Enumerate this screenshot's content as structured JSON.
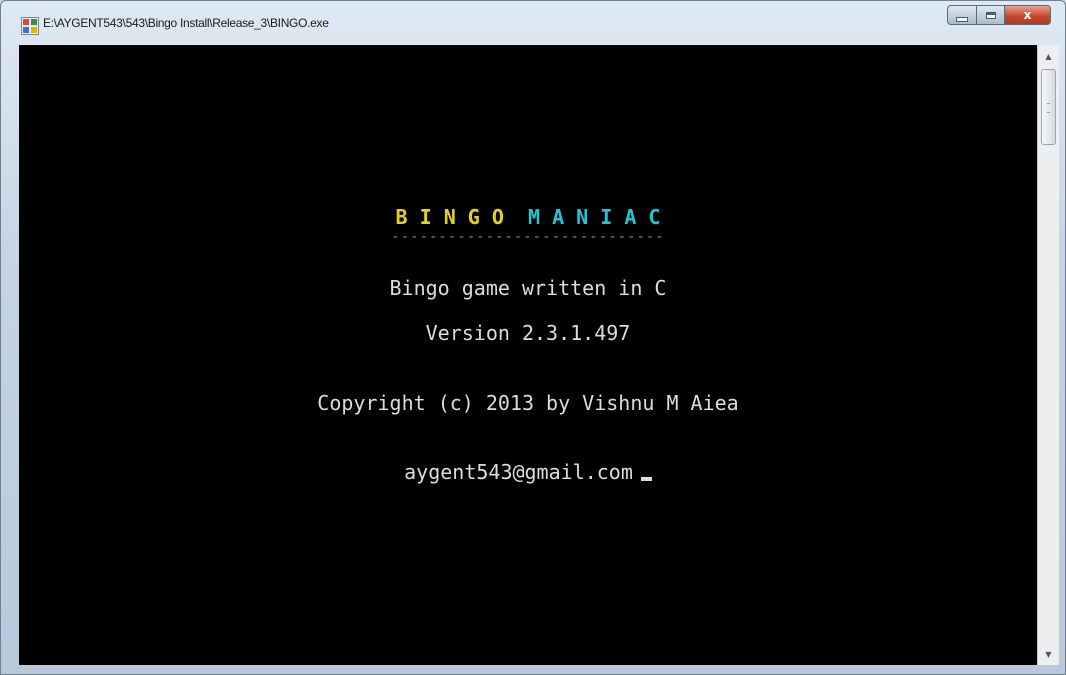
{
  "window": {
    "title": "E:\\AYGENT543\\543\\Bingo Install\\Release_3\\BINGO.exe",
    "controls": {
      "minimize": "",
      "maximize": "",
      "close": "x"
    }
  },
  "console": {
    "title_part1": "B I N G O",
    "title_part2": "M A N I A C",
    "underline": "-----------------------------",
    "line1": "Bingo game written in C",
    "line2": "Version 2.3.1.497",
    "line3": "Copyright (c) 2013 by Vishnu M Aiea",
    "line4": "aygent543@gmail.com",
    "colors": {
      "bingo": "#e7d21a",
      "maniac": "#21c6d6",
      "text": "#dcdcdc",
      "background": "#000000"
    }
  },
  "scrollbar": {
    "up_icon": "arrow-up-icon",
    "down_icon": "arrow-down-icon"
  }
}
